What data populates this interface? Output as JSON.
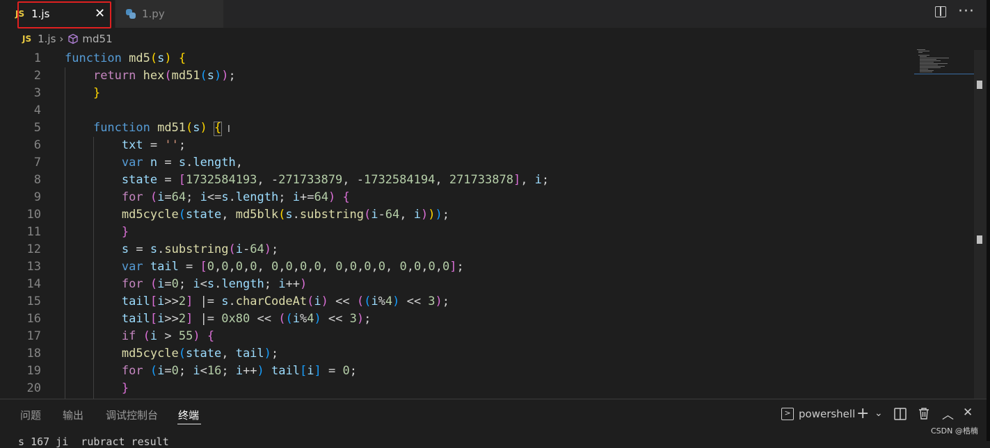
{
  "tabs": [
    {
      "label": "1.js",
      "icon": "JS",
      "active": true,
      "close": "✕"
    },
    {
      "label": "1.py",
      "icon": "python-icon",
      "active": false
    }
  ],
  "breadcrumb": {
    "file_icon": "JS",
    "file": "1.js",
    "symbol": "md51"
  },
  "editor": {
    "line_numbers": [
      "1",
      "2",
      "3",
      "4",
      "5",
      "6",
      "7",
      "8",
      "9",
      "10",
      "11",
      "12",
      "13",
      "14",
      "15",
      "16",
      "17",
      "18",
      "19",
      "20"
    ]
  },
  "panel": {
    "tabs": [
      "问题",
      "输出",
      "调试控制台",
      "终端"
    ],
    "active_tab": "终端",
    "terminal_name": "powershell",
    "terminal_text": "s 167 ji  rubract result"
  },
  "watermark": "CSDN @梏楠",
  "colors": {
    "editor_bg": "#1e1e1e",
    "keyword": "#569cd6",
    "control": "#c586c0",
    "function": "#dcdcaa",
    "variable": "#9cdcfe",
    "number": "#b5cea8",
    "highlight_box": "#e02020"
  }
}
